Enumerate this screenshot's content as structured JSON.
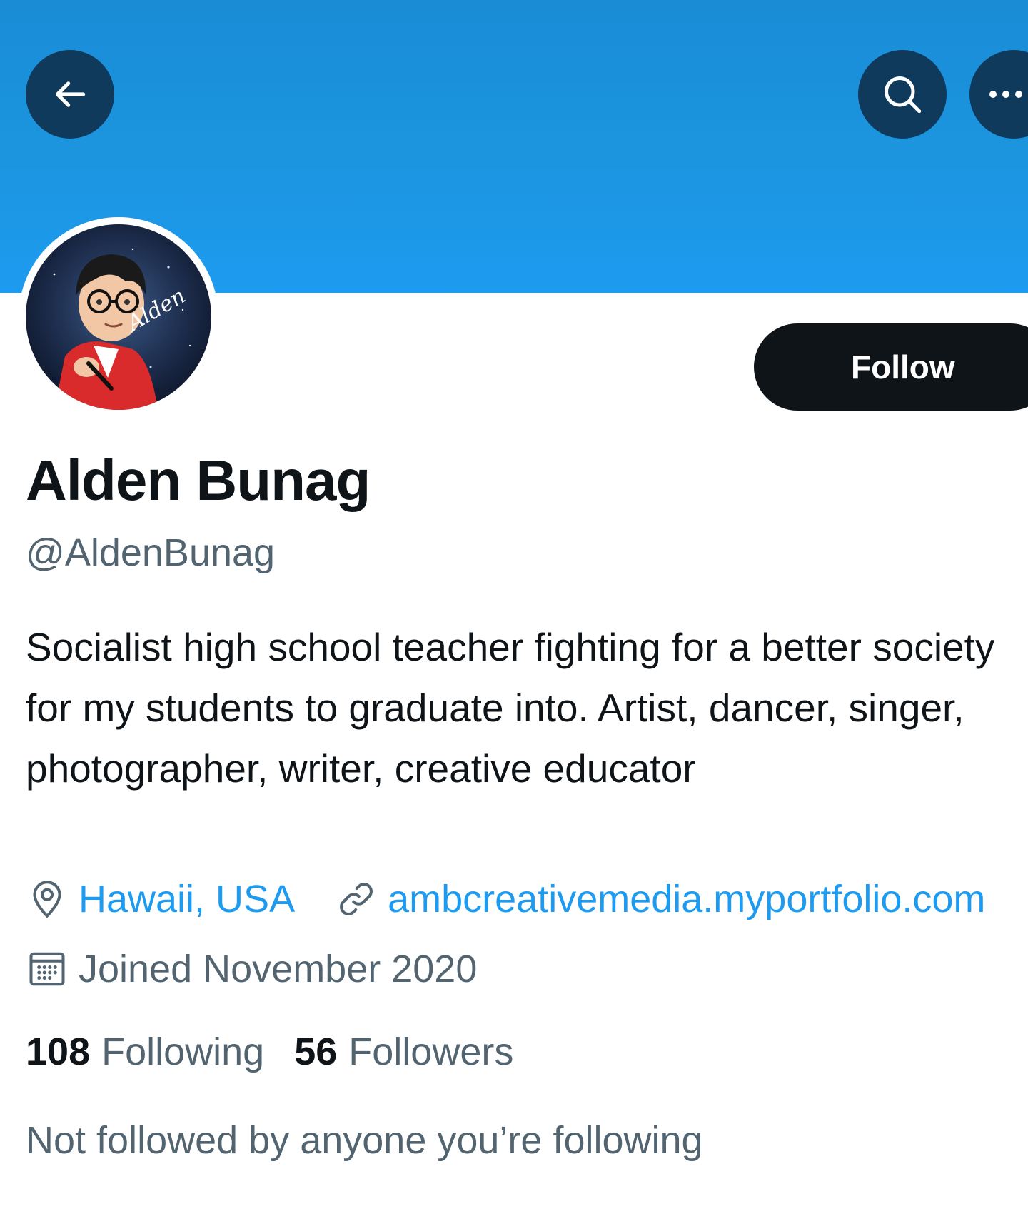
{
  "header": {
    "back_icon": "arrow-left-icon",
    "search_icon": "search-icon",
    "more_icon": "more-horizontal-icon",
    "banner_color": "#1d9bf0"
  },
  "profile": {
    "avatar_signature": "Alden",
    "follow_label": "Follow",
    "display_name": "Alden Bunag",
    "handle": "@AldenBunag",
    "bio": "Socialist high school teacher fighting for a better society for my students to graduate into. Artist, dancer, singer, photographer, writer, creative educator",
    "location": "Hawaii, USA",
    "website": "ambcreativemedia.myportfolio.com",
    "joined": "Joined November 2020",
    "following_count": "108",
    "following_label": "Following",
    "followers_count": "56",
    "followers_label": "Followers",
    "mutuals_note": "Not followed by anyone you’re following"
  },
  "colors": {
    "link": "#1d9bf0",
    "secondary_text": "#536471",
    "primary_text": "#0f1419",
    "button_dark": "#0f1419"
  }
}
